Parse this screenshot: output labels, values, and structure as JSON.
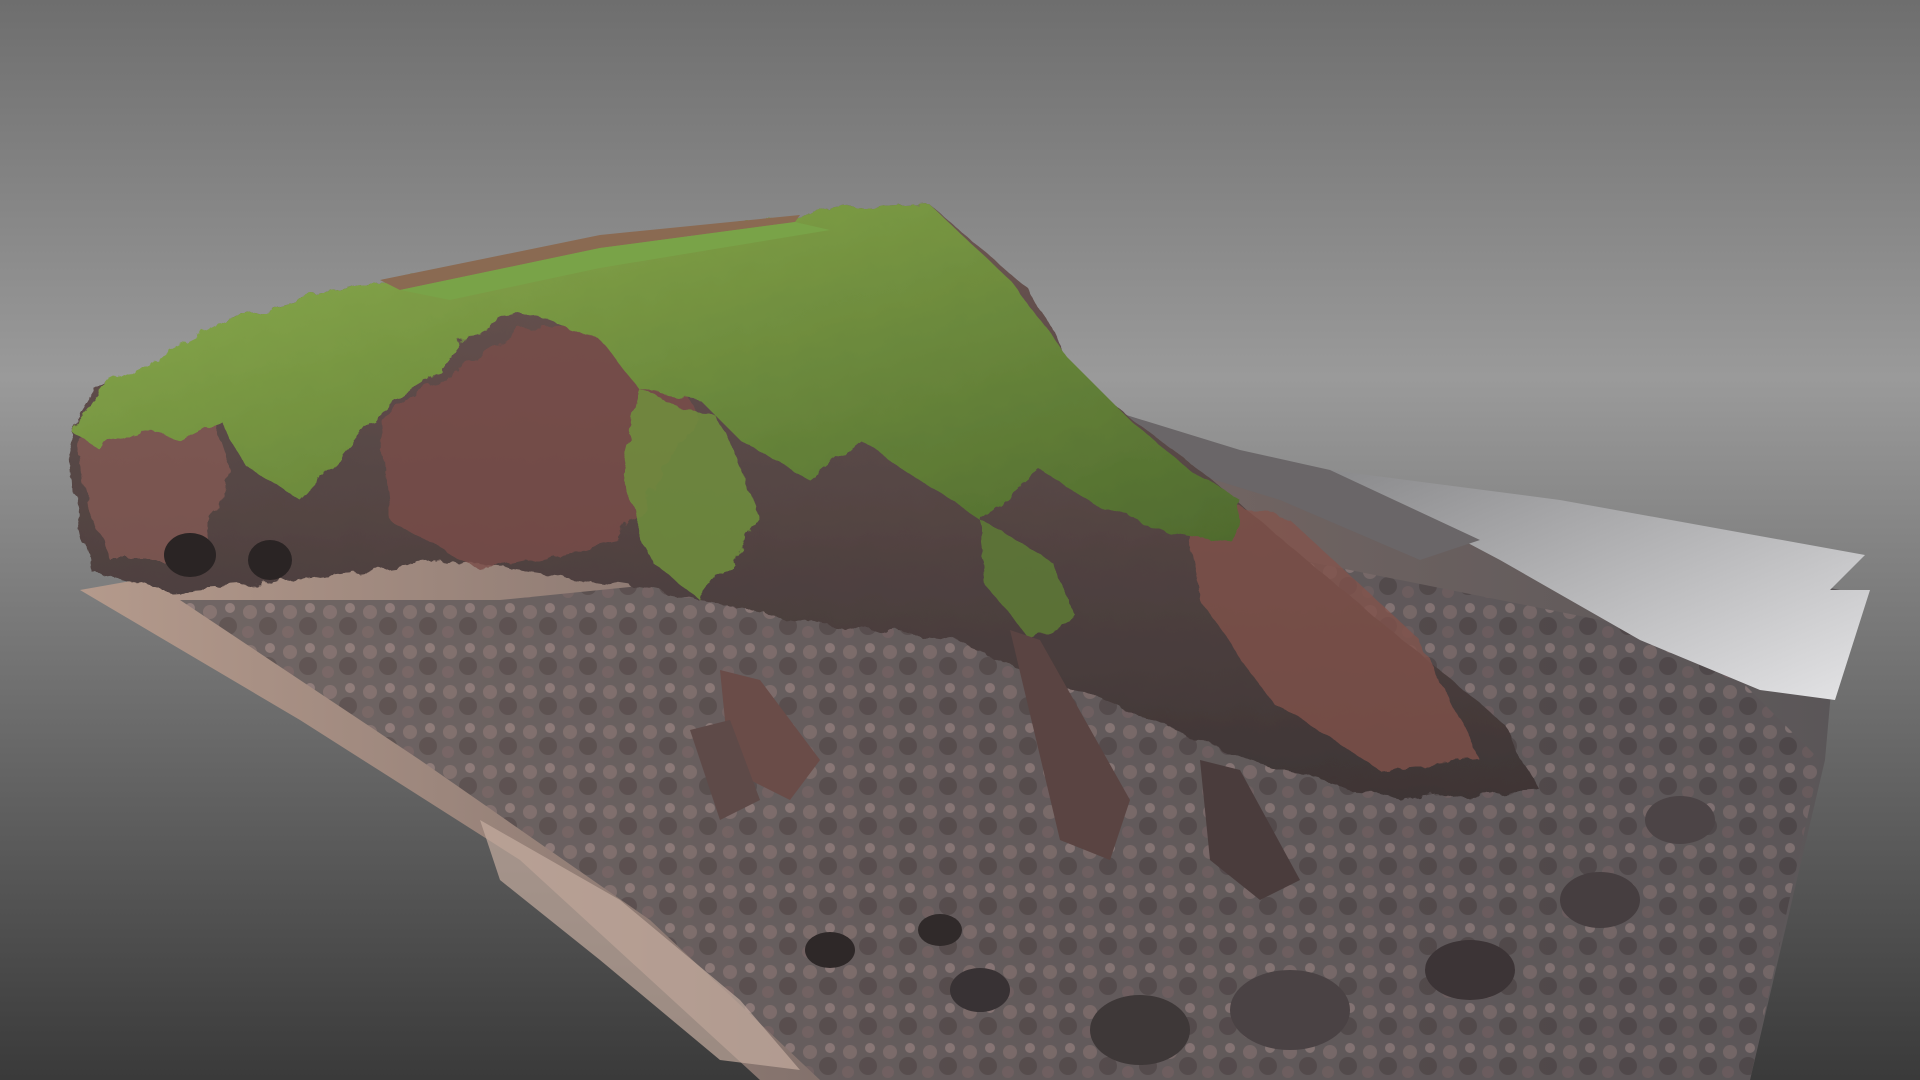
{
  "scene": {
    "subject": "photogrammetry-mesh",
    "colors": {
      "background_top": "#9a9a9a",
      "background_mid": "#727272",
      "background_bottom": "#3c3c3c",
      "grass_light": "#8fb04e",
      "grass_dark": "#4f6a2e",
      "rock_red": "#7a4e4a",
      "rock_dark": "#3e3535",
      "rock_grey": "#5c5658",
      "beach_sand": "#b49a8c",
      "beach_grey": "#6a6668",
      "water_shine": "#d8d8da",
      "field_brown": "#8a6a52"
    }
  }
}
